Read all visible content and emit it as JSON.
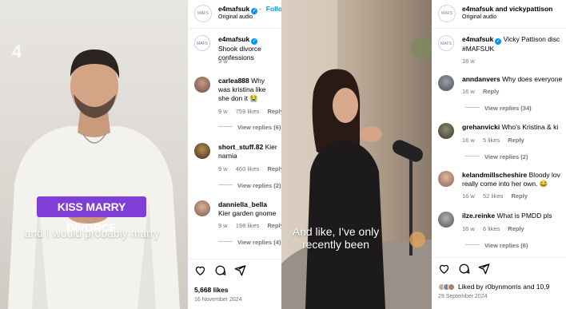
{
  "video1": {
    "logo_icon": "channel-4-logo-icon",
    "badge": "KISS MARRY DIVORCE",
    "subtitle": "and I would probably marry"
  },
  "feed1": {
    "header": {
      "username": "e4mafsuk",
      "follow_label": "Follo",
      "sub": "Original audio"
    },
    "caption": {
      "username": "e4mafsuk",
      "text": "Shook divorce confessions",
      "time": "9 w"
    },
    "comments": [
      {
        "username": "carlea888",
        "text": "Why was kristina like she don it 😭",
        "time": "9 w",
        "likes": "759 likes",
        "reply": "Reply",
        "view_replies": "View replies (6)"
      },
      {
        "username": "short_stuff.82",
        "text": "Kier narnia",
        "time": "9 w",
        "likes": "460 likes",
        "reply": "Reply",
        "view_replies": "View replies (2)"
      },
      {
        "username": "danniella_bella",
        "text": "Kier garden gnome",
        "time": "9 w",
        "likes": "198 likes",
        "reply": "Reply",
        "view_replies": "View replies (4)"
      }
    ],
    "likes": "5,668 likes",
    "date": "16 November 2024"
  },
  "video2": {
    "subtitle": "And like, I've only recently been"
  },
  "feed2": {
    "header": {
      "username": "e4mafsuk and vickypattison",
      "sub": "Original audio"
    },
    "caption": {
      "username": "e4mafsuk",
      "text": "Vicky Pattison disc #MAFSUK",
      "time": "16 w"
    },
    "comments": [
      {
        "username": "anndanvers",
        "text": "Why does everyone",
        "time": "16 w",
        "likes": "",
        "reply": "Reply",
        "view_replies": "View replies (34)"
      },
      {
        "username": "grehanvicki",
        "text": "Who's Kristina & ki",
        "time": "16 w",
        "likes": "5 likes",
        "reply": "Reply",
        "view_replies": "View replies (2)"
      },
      {
        "username": "kelandmillscheshire",
        "text": "Bloody lov really come into her own. 😂",
        "time": "16 w",
        "likes": "52 likes",
        "reply": "Reply",
        "view_replies": ""
      },
      {
        "username": "ilze.reinke",
        "text": "What is PMDD pls",
        "time": "16 w",
        "likes": "6 likes",
        "reply": "Reply",
        "view_replies": "View replies (6)"
      }
    ],
    "liked_by": "Liked by r0bynmorris and 10,9",
    "date": "29 September 2024"
  },
  "colors": {
    "badge": "#7f3fd6",
    "link": "#0095f6",
    "meta": "#737373"
  }
}
